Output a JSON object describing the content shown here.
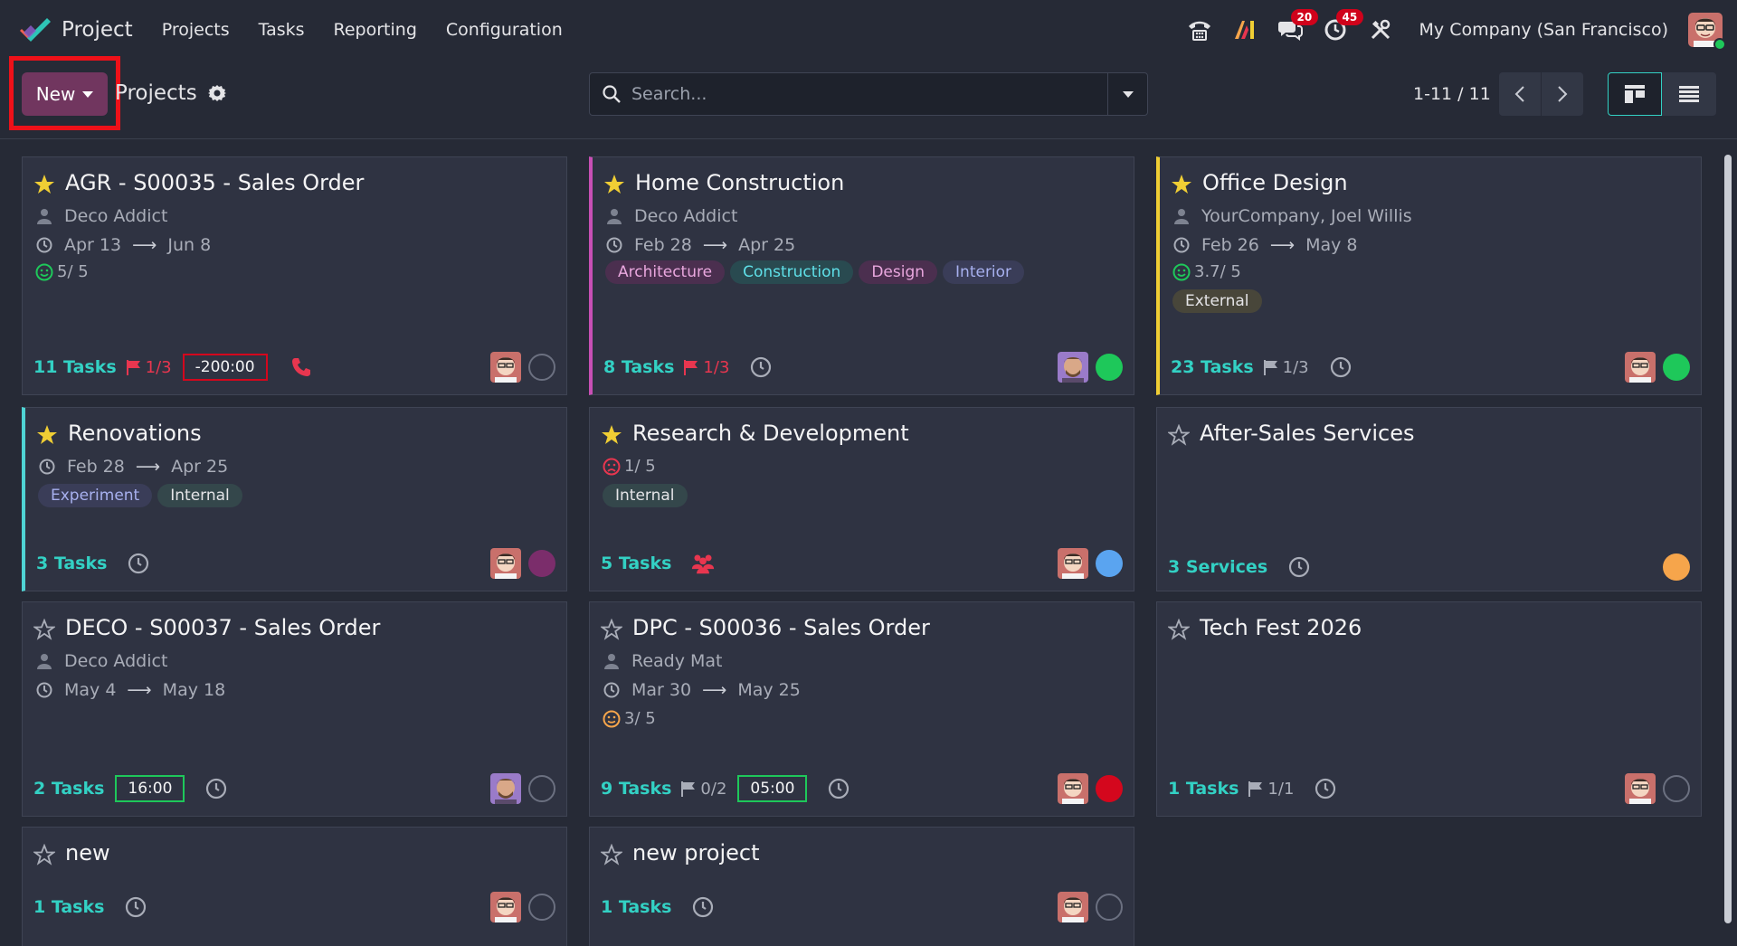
{
  "navbar": {
    "app_name": "Project",
    "menu": [
      "Projects",
      "Tasks",
      "Reporting",
      "Configuration"
    ],
    "badges": {
      "messages": "20",
      "activities": "45"
    },
    "company": "My Company (San Francisco)"
  },
  "control": {
    "new_label": "New",
    "breadcrumb": "Projects",
    "search_placeholder": "Search...",
    "pager": "1-11 / 11"
  },
  "cards": [
    {
      "title": "AGR - S00035 - Sales Order",
      "starred": true,
      "customer": "Deco Addict",
      "date_start": "Apr 13",
      "date_end": "Jun 8",
      "rating": "5/ 5",
      "tasks": "11 Tasks",
      "milestone": "1/3",
      "hours": "-200:00"
    },
    {
      "title": "Home Construction",
      "starred": true,
      "customer": "Deco Addict",
      "date_start": "Feb 28",
      "date_end": "Apr 25",
      "tags": [
        "Architecture",
        "Construction",
        "Design",
        "Interior"
      ],
      "tasks": "8 Tasks",
      "milestone": "1/3"
    },
    {
      "title": "Office Design",
      "starred": true,
      "customer": "YourCompany, Joel Willis",
      "date_start": "Feb 26",
      "date_end": "May 8",
      "rating": "3.7/ 5",
      "tags": [
        "External"
      ],
      "tasks": "23 Tasks",
      "milestone": "1/3"
    },
    {
      "title": "Renovations",
      "starred": true,
      "date_start": "Feb 28",
      "date_end": "Apr 25",
      "tags": [
        "Experiment",
        "Internal"
      ],
      "tasks": "3 Tasks"
    },
    {
      "title": "Research & Development",
      "starred": true,
      "rating": "1/ 5",
      "tags": [
        "Internal"
      ],
      "tasks": "5 Tasks"
    },
    {
      "title": "After-Sales Services",
      "starred": false,
      "tasks": "3 Services"
    },
    {
      "title": "DECO - S00037 - Sales Order",
      "starred": false,
      "customer": "Deco Addict",
      "date_start": "May 4",
      "date_end": "May 18",
      "tasks": "2 Tasks",
      "hours": "16:00"
    },
    {
      "title": "DPC - S00036 - Sales Order",
      "starred": false,
      "customer": "Ready Mat",
      "date_start": "Mar 30",
      "date_end": "May 25",
      "rating": "3/ 5",
      "tasks": "9 Tasks",
      "milestone": "0/2",
      "hours": "05:00"
    },
    {
      "title": "Tech Fest 2026",
      "starred": false,
      "tasks": "1 Tasks",
      "milestone": "1/1"
    },
    {
      "title": "new",
      "starred": false,
      "tasks": "1 Tasks"
    },
    {
      "title": "new project",
      "starred": false,
      "tasks": "1 Tasks"
    }
  ],
  "colors": {
    "accent_new_button": "#71365f",
    "highlight_box": "#ee1119",
    "tasks_link": "#33d1c4",
    "milestone_red": "#e8364f",
    "status_green": "#1ec85a",
    "status_red": "#d4071d",
    "status_blue": "#5aa4f0",
    "status_orange": "#f6a54b",
    "status_purple": "#7b2d6b"
  }
}
